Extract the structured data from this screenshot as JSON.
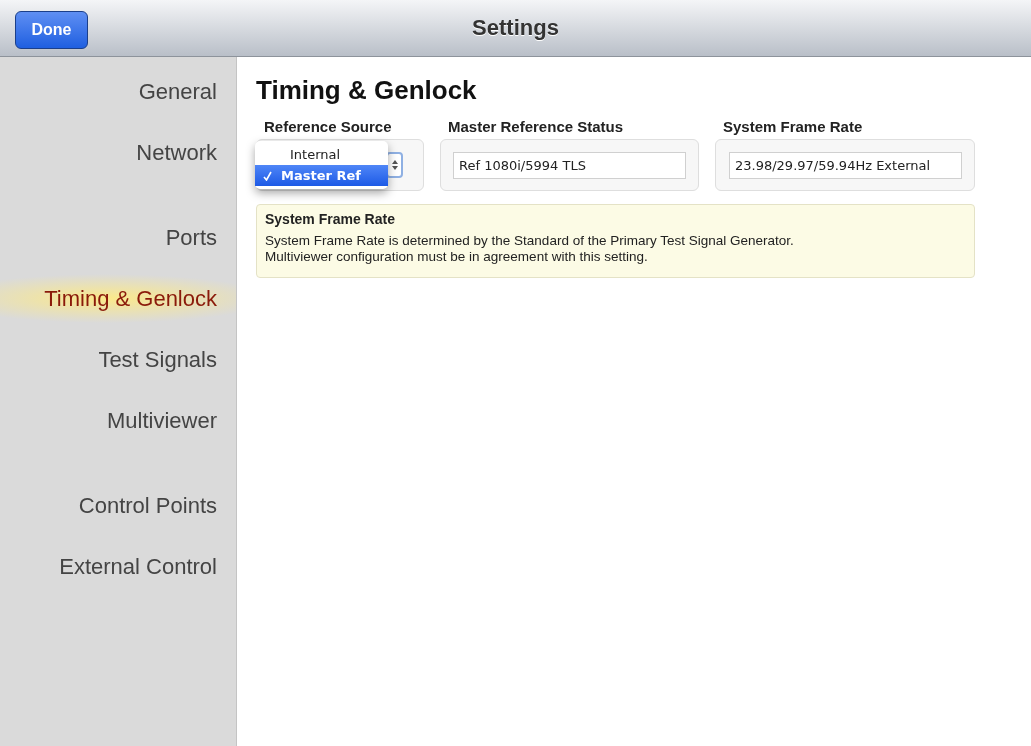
{
  "nav_bar": {
    "done_button": "Done",
    "title": "Settings"
  },
  "sidebar": {
    "groups": [
      {
        "items": [
          {
            "label": "General",
            "selected": false
          },
          {
            "label": "Network",
            "selected": false
          }
        ]
      },
      {
        "items": [
          {
            "label": "Ports",
            "selected": false
          },
          {
            "label": "Timing & Genlock",
            "selected": true
          },
          {
            "label": "Test Signals",
            "selected": false
          },
          {
            "label": "Multiviewer",
            "selected": false
          }
        ]
      },
      {
        "items": [
          {
            "label": "Control Points",
            "selected": false
          },
          {
            "label": "External Control",
            "selected": false
          }
        ]
      }
    ]
  },
  "page": {
    "title": "Timing & Genlock",
    "fields": [
      {
        "kind": "select",
        "label": "Reference Source",
        "options": [
          {
            "label": "Internal",
            "selected": false
          },
          {
            "label": "Master Ref",
            "selected": true
          }
        ]
      },
      {
        "kind": "text",
        "label": "Master Reference Status",
        "value": "Ref 1080i/5994 TLS"
      },
      {
        "kind": "text",
        "label": "System Frame Rate",
        "value": "23.98/29.97/59.94Hz External"
      }
    ],
    "note": {
      "title": "System Frame Rate",
      "lines": [
        "System Frame Rate is determined by the Standard of the Primary Test Signal Generator.",
        "Multiviewer configuration must be in agreement with this setting."
      ]
    }
  }
}
